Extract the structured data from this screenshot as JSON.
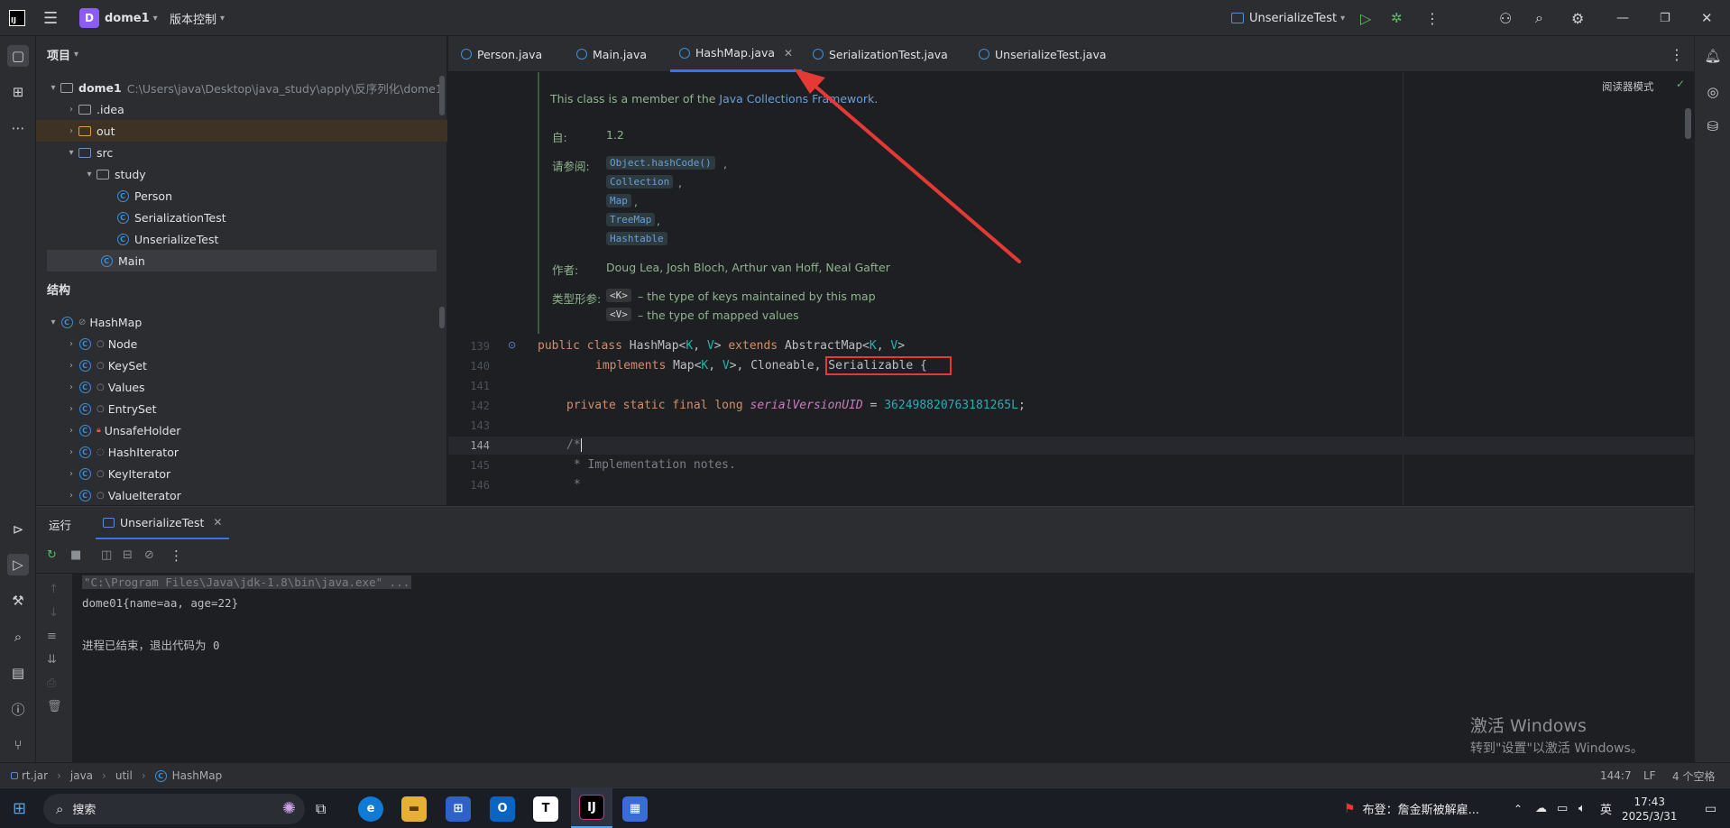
{
  "titlebar": {
    "project_badge": "D",
    "project_name": "dome1",
    "vcs_label": "版本控制",
    "run_config": "UnserializeTest"
  },
  "project_panel": {
    "title": "项目",
    "items": [
      {
        "label": "dome1",
        "path": "C:\\Users\\java\\Desktop\\java_study\\apply\\反序列化\\dome1"
      },
      {
        "label": ".idea"
      },
      {
        "label": "out"
      },
      {
        "label": "src"
      },
      {
        "label": "study"
      },
      {
        "label": "Person"
      },
      {
        "label": "SerializationTest"
      },
      {
        "label": "UnserializeTest"
      },
      {
        "label": "Main"
      }
    ]
  },
  "structure_panel": {
    "title": "结构",
    "items": [
      {
        "label": "HashMap"
      },
      {
        "label": "Node"
      },
      {
        "label": "KeySet"
      },
      {
        "label": "Values"
      },
      {
        "label": "EntrySet"
      },
      {
        "label": "UnsafeHolder"
      },
      {
        "label": "HashIterator"
      },
      {
        "label": "KeyIterator"
      },
      {
        "label": "ValueIterator"
      }
    ]
  },
  "tabs": [
    {
      "label": "Person.java"
    },
    {
      "label": "Main.java"
    },
    {
      "label": "HashMap.java"
    },
    {
      "label": "SerializationTest.java"
    },
    {
      "label": "UnserializeTest.java"
    }
  ],
  "editor": {
    "reader_mode": "阅读器模式",
    "doc": {
      "member_prefix": "This class is a member of the ",
      "member_link": "Java Collections Framework",
      "member_suffix": ".",
      "since_label": "自:",
      "since_value": "1.2",
      "see_label": "请参阅:",
      "see_refs": [
        "Object.hashCode()",
        "Collection",
        "Map",
        "TreeMap",
        "Hashtable"
      ],
      "author_label": "作者:",
      "author_value": "Doug Lea, Josh Bloch, Arthur van Hoff, Neal Gafter",
      "type_param_label": "类型形参:",
      "type_params": [
        {
          "name": "<K>",
          "desc": "– the type of keys maintained by this map"
        },
        {
          "name": "<V>",
          "desc": "– the type of mapped values"
        }
      ]
    },
    "line_numbers": [
      "139",
      "140",
      "141",
      "142",
      "143",
      "144",
      "145",
      "146"
    ],
    "code": {
      "l139_a": "public class ",
      "l139_b": "HashMap<",
      "l139_c": "K",
      "l139_d": ", ",
      "l139_e": "V",
      "l139_f": "> ",
      "l139_g": "extends ",
      "l139_h": "AbstractMap<",
      "l139_i": "K",
      "l139_j": ", ",
      "l139_k": "V",
      "l139_l": ">",
      "l140_a": "implements ",
      "l140_b": "Map<",
      "l140_c": "K",
      "l140_d": ", ",
      "l140_e": "V",
      "l140_f": ">, Cloneable, ",
      "l140_g": "Serializable {",
      "l142_a": "private static final long ",
      "l142_b": "serialVersionUID",
      "l142_c": " = ",
      "l142_d": "362498820763181265L",
      "l142_e": ";",
      "l144": "/*",
      "l145": " * Implementation notes.",
      "l146": " *"
    }
  },
  "run_panel": {
    "title": "运行",
    "tab": "UnserializeTest",
    "console": [
      "\"C:\\Program Files\\Java\\jdk-1.8\\bin\\java.exe\" ...",
      "dome01{name=aa, age=22}",
      "",
      "进程已结束，退出代码为 0"
    ]
  },
  "watermark": {
    "line1": "激活 Windows",
    "line2": "转到\"设置\"以激活 Windows。"
  },
  "statusbar": {
    "crumbs": [
      "rt.jar",
      "java",
      "util",
      "HashMap"
    ],
    "position": "144:7",
    "line_sep": "LF",
    "indent": "4 个空格"
  },
  "taskbar": {
    "search": "搜索",
    "news": "布登：詹金斯被解雇...",
    "ime": "英",
    "time": "17:43",
    "date": "2025/3/31"
  }
}
